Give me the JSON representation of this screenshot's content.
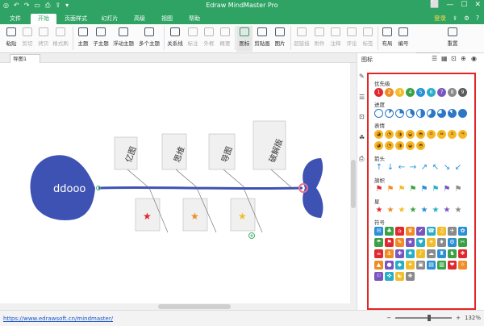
{
  "app": {
    "title": "Edraw MindMaster Pro",
    "qa": [
      "◎",
      "↶",
      "↷",
      "▭",
      "⎙",
      "⇪",
      "▾"
    ],
    "wc": [
      "⬜",
      "—",
      "☐",
      "✕"
    ]
  },
  "menu": {
    "tabs": [
      "文件",
      "开始",
      "页面样式",
      "幻灯片",
      "高级",
      "视图",
      "帮助"
    ],
    "active": 1,
    "login": "登录",
    "share": "⇪",
    "settings": "⚙",
    "help": "?"
  },
  "ribbon": {
    "paste": "粘贴",
    "cut": "剪切",
    "copy": "拷贝",
    "format": "格式刷",
    "topic": "主题",
    "subtopic": "子主题",
    "float": "浮动主题",
    "multi": "多个主题",
    "relation": "关系线",
    "callout": "标注",
    "border": "外框",
    "summary": "概要",
    "icon": "图标",
    "clipart": "剪贴画",
    "image": "图片",
    "link": "超链接",
    "attach": "附件",
    "comment": "注释",
    "note": "评论",
    "tag": "标签",
    "layout": "布局",
    "number": "编号",
    "spin1": "30",
    "spin2": "30",
    "reset": "重置"
  },
  "document": {
    "tab": "导图1"
  },
  "map": {
    "head": "ddooo",
    "upper": [
      "亿图",
      "思维",
      "导图",
      "破解版"
    ],
    "colors": {
      "fish": "#3e52b3",
      "tail_marker": "#f07090"
    }
  },
  "sidebar": {
    "title": "图标",
    "tools": [
      "☰",
      "▦",
      "⊡",
      "⊕",
      "◉"
    ],
    "vtools": [
      "✎",
      "☰",
      "⊡",
      "☘",
      "⎙"
    ]
  },
  "panel": {
    "priority": {
      "label": "优先级",
      "items": [
        "1",
        "2",
        "3",
        "4",
        "5",
        "6",
        "7",
        "8",
        "9"
      ],
      "colors": [
        "#e0282f",
        "#f08c25",
        "#f2bd2a",
        "#3ca046",
        "#2b8fd6",
        "#2aaec8",
        "#7a55c0",
        "#8a8a8a",
        "#5a5a5a"
      ]
    },
    "progress": {
      "label": "进度",
      "values": [
        0,
        0.125,
        0.25,
        0.375,
        0.5,
        0.625,
        0.75,
        0.875,
        1
      ]
    },
    "emotion": {
      "label": "表情",
      "faces": [
        "◕",
        "◔",
        "◑",
        "◒",
        "◓",
        "ㅇ",
        "ㅂ",
        "ㅈ",
        "ㅋ",
        "◕",
        "◔",
        "◑",
        "◒",
        "◓"
      ]
    },
    "arrows": {
      "label": "箭头",
      "items": [
        "↑",
        "↓",
        "←",
        "→",
        "↗",
        "↖",
        "↘",
        "↙"
      ]
    },
    "flags": {
      "label": "旗帜",
      "colors": [
        "#e0282f",
        "#f08c25",
        "#f2bd2a",
        "#3ca046",
        "#2b8fd6",
        "#2aaec8",
        "#7a55c0",
        "#8a8a8a"
      ]
    },
    "stars": {
      "label": "星",
      "colors": [
        "#e0282f",
        "#f08c25",
        "#f2bd2a",
        "#3ca046",
        "#2b8fd6",
        "#2aaec8",
        "#7a55c0",
        "#8a8a8a"
      ]
    },
    "symbols": {
      "label": "符号",
      "glyphs": [
        "✉",
        "♣",
        "⌂",
        "♛",
        "✔",
        "☎",
        "♫",
        "✈",
        "✿",
        "☂",
        "⚑",
        "✎",
        "★",
        "♥",
        "☀",
        "♦",
        "⚙",
        "✂",
        "☕",
        "⚓",
        "✚",
        "♠",
        "♪",
        "☁",
        "♜",
        "♞",
        "❖",
        "▲",
        "●",
        "◆",
        "✦",
        "▣",
        "▤",
        "▥",
        "❤",
        "☼",
        "⚐",
        "✜",
        "☯",
        "❋"
      ],
      "colors": [
        "#2b8fd6",
        "#3ca046",
        "#e0282f",
        "#f08c25",
        "#7a55c0",
        "#2aaec8",
        "#f2bd2a",
        "#8a8a8a"
      ]
    }
  },
  "status": {
    "url": "https://www.edrawsoft.cn/mindmaster/",
    "zoom": "132%",
    "minus": "−",
    "plus": "+"
  }
}
